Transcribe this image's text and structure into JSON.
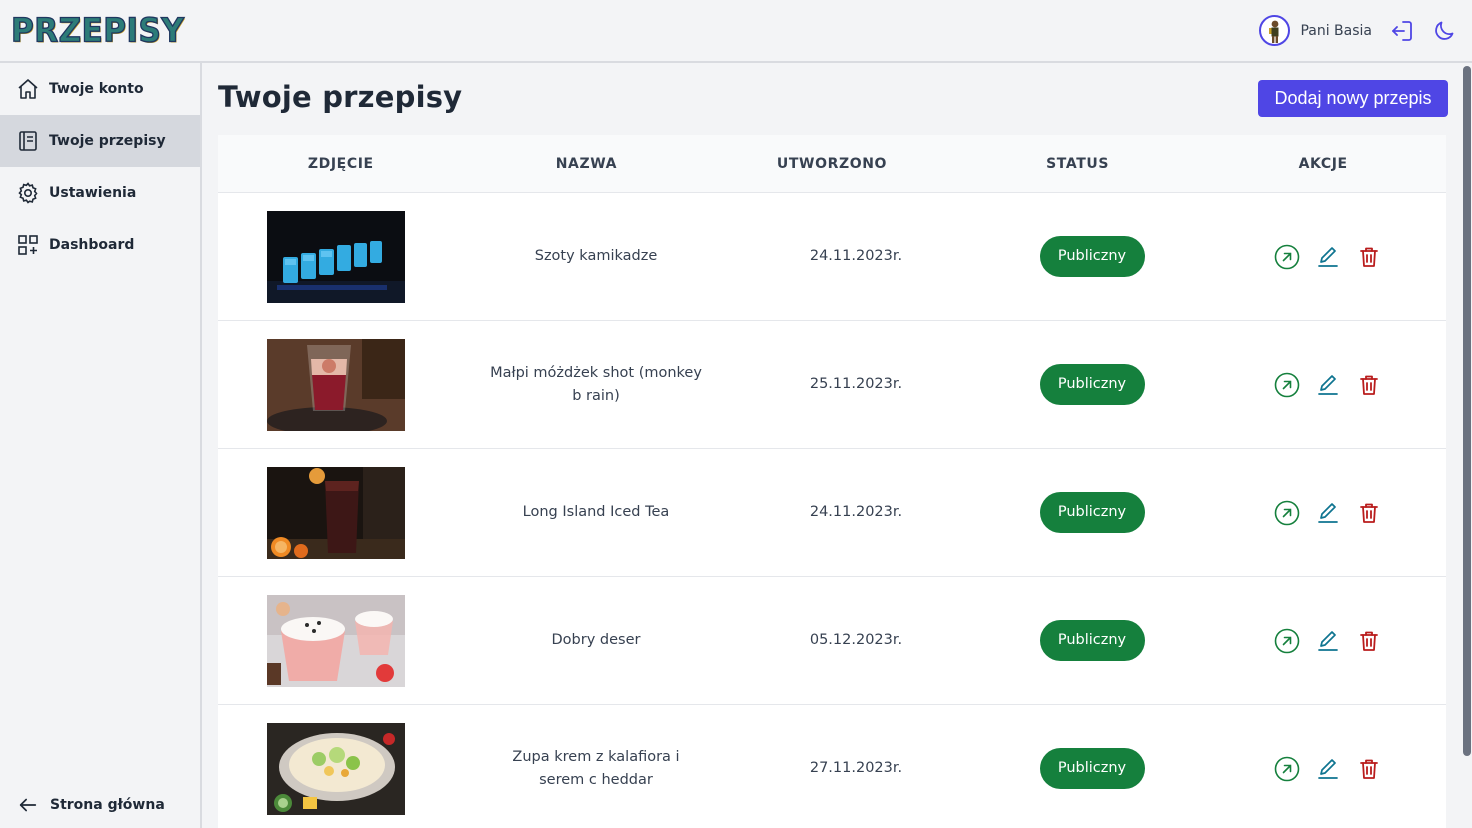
{
  "app": {
    "logo": "PRZEPISY",
    "user_name": "Pani Basia"
  },
  "sidebar": {
    "items": [
      {
        "label": "Twoje konto",
        "icon": "home-icon"
      },
      {
        "label": "Twoje przepisy",
        "icon": "notebook-icon",
        "active": true
      },
      {
        "label": "Ustawienia",
        "icon": "gear-icon"
      },
      {
        "label": "Dashboard",
        "icon": "dashboard-icon"
      }
    ],
    "back_label": "Strona główna"
  },
  "main": {
    "title": "Twoje przepisy",
    "add_button": "Dodaj nowy przepis",
    "columns": [
      "ZDJĘCIE",
      "NAZWA",
      "UTWORZONO",
      "STATUS",
      "AKCJE"
    ],
    "rows": [
      {
        "name": "Szoty kamikadze",
        "created": "24.11.2023r.",
        "status": "Publiczny",
        "photo": "blue shots"
      },
      {
        "name": "Małpi móżdżek shot (monkey b rain)",
        "created": "25.11.2023r.",
        "status": "Publiczny",
        "photo": "layered shot"
      },
      {
        "name": "Long Island Iced Tea",
        "created": "24.11.2023r.",
        "status": "Publiczny",
        "photo": "iced tea glass"
      },
      {
        "name": "Dobry deser",
        "created": "05.12.2023r.",
        "status": "Publiczny",
        "photo": "dessert cups"
      },
      {
        "name": "Zupa krem z kalafiora i serem c heddar",
        "created": "27.11.2023r.",
        "status": "Publiczny",
        "photo": "soup bowl"
      }
    ]
  },
  "colors": {
    "accent": "#4f46e5",
    "status_green": "#15803d",
    "open_icon": "#15803d",
    "edit_icon": "#0e7490",
    "delete_icon": "#b91c1c"
  }
}
